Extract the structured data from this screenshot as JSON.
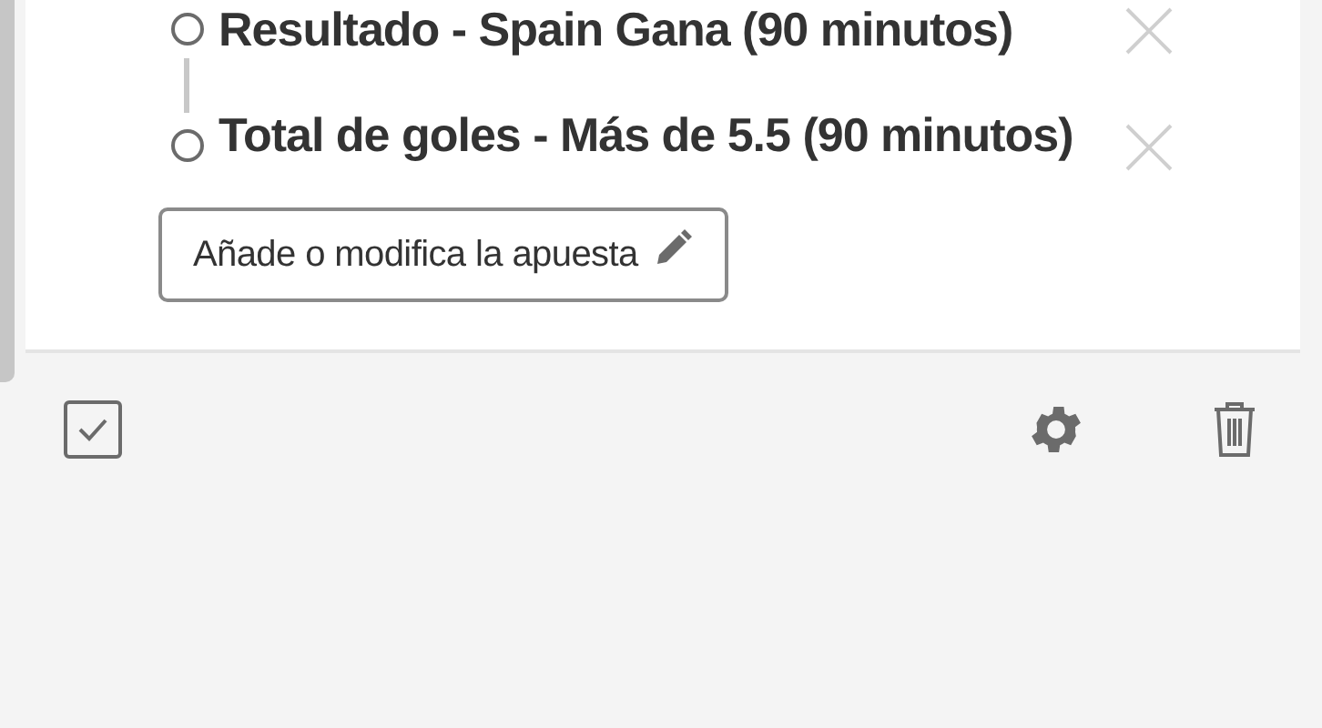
{
  "bet_slip": {
    "legs": [
      {
        "selection": "Resultado - Spain Gana (90 minutos)"
      },
      {
        "selection": "Total de goles - Más de 5.5 (90 minutos)"
      }
    ],
    "edit_button": {
      "label": "Añade o modifica la apuesta"
    }
  },
  "toolbar": {
    "select_all": {
      "checked": true
    }
  }
}
